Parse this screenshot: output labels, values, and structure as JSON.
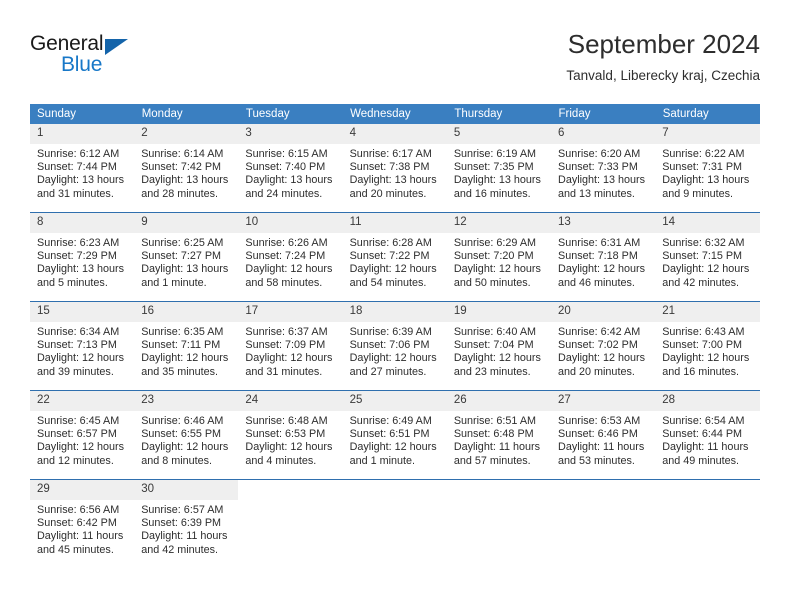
{
  "brand": {
    "word1": "General",
    "word2": "Blue",
    "triangle_color": "#1464aa",
    "blue_color": "#1878c8"
  },
  "header": {
    "title": "September 2024",
    "subtitle": "Tanvald, Liberecky kraj, Czechia"
  },
  "theme": {
    "header_band": "#3a7fc1",
    "row_divider": "#2f6fae",
    "daynum_band": "#efefef",
    "text": "#2d2d2d"
  },
  "weekdays": [
    "Sunday",
    "Monday",
    "Tuesday",
    "Wednesday",
    "Thursday",
    "Friday",
    "Saturday"
  ],
  "labels": {
    "sunrise": "Sunrise:",
    "sunset": "Sunset:",
    "daylight": "Daylight:"
  },
  "weeks": [
    [
      {
        "day": "1",
        "sunrise": "Sunrise: 6:12 AM",
        "sunset": "Sunset: 7:44 PM",
        "daylight_l1": "Daylight: 13 hours",
        "daylight_l2": "and 31 minutes."
      },
      {
        "day": "2",
        "sunrise": "Sunrise: 6:14 AM",
        "sunset": "Sunset: 7:42 PM",
        "daylight_l1": "Daylight: 13 hours",
        "daylight_l2": "and 28 minutes."
      },
      {
        "day": "3",
        "sunrise": "Sunrise: 6:15 AM",
        "sunset": "Sunset: 7:40 PM",
        "daylight_l1": "Daylight: 13 hours",
        "daylight_l2": "and 24 minutes."
      },
      {
        "day": "4",
        "sunrise": "Sunrise: 6:17 AM",
        "sunset": "Sunset: 7:38 PM",
        "daylight_l1": "Daylight: 13 hours",
        "daylight_l2": "and 20 minutes."
      },
      {
        "day": "5",
        "sunrise": "Sunrise: 6:19 AM",
        "sunset": "Sunset: 7:35 PM",
        "daylight_l1": "Daylight: 13 hours",
        "daylight_l2": "and 16 minutes."
      },
      {
        "day": "6",
        "sunrise": "Sunrise: 6:20 AM",
        "sunset": "Sunset: 7:33 PM",
        "daylight_l1": "Daylight: 13 hours",
        "daylight_l2": "and 13 minutes."
      },
      {
        "day": "7",
        "sunrise": "Sunrise: 6:22 AM",
        "sunset": "Sunset: 7:31 PM",
        "daylight_l1": "Daylight: 13 hours",
        "daylight_l2": "and 9 minutes."
      }
    ],
    [
      {
        "day": "8",
        "sunrise": "Sunrise: 6:23 AM",
        "sunset": "Sunset: 7:29 PM",
        "daylight_l1": "Daylight: 13 hours",
        "daylight_l2": "and 5 minutes."
      },
      {
        "day": "9",
        "sunrise": "Sunrise: 6:25 AM",
        "sunset": "Sunset: 7:27 PM",
        "daylight_l1": "Daylight: 13 hours",
        "daylight_l2": "and 1 minute."
      },
      {
        "day": "10",
        "sunrise": "Sunrise: 6:26 AM",
        "sunset": "Sunset: 7:24 PM",
        "daylight_l1": "Daylight: 12 hours",
        "daylight_l2": "and 58 minutes."
      },
      {
        "day": "11",
        "sunrise": "Sunrise: 6:28 AM",
        "sunset": "Sunset: 7:22 PM",
        "daylight_l1": "Daylight: 12 hours",
        "daylight_l2": "and 54 minutes."
      },
      {
        "day": "12",
        "sunrise": "Sunrise: 6:29 AM",
        "sunset": "Sunset: 7:20 PM",
        "daylight_l1": "Daylight: 12 hours",
        "daylight_l2": "and 50 minutes."
      },
      {
        "day": "13",
        "sunrise": "Sunrise: 6:31 AM",
        "sunset": "Sunset: 7:18 PM",
        "daylight_l1": "Daylight: 12 hours",
        "daylight_l2": "and 46 minutes."
      },
      {
        "day": "14",
        "sunrise": "Sunrise: 6:32 AM",
        "sunset": "Sunset: 7:15 PM",
        "daylight_l1": "Daylight: 12 hours",
        "daylight_l2": "and 42 minutes."
      }
    ],
    [
      {
        "day": "15",
        "sunrise": "Sunrise: 6:34 AM",
        "sunset": "Sunset: 7:13 PM",
        "daylight_l1": "Daylight: 12 hours",
        "daylight_l2": "and 39 minutes."
      },
      {
        "day": "16",
        "sunrise": "Sunrise: 6:35 AM",
        "sunset": "Sunset: 7:11 PM",
        "daylight_l1": "Daylight: 12 hours",
        "daylight_l2": "and 35 minutes."
      },
      {
        "day": "17",
        "sunrise": "Sunrise: 6:37 AM",
        "sunset": "Sunset: 7:09 PM",
        "daylight_l1": "Daylight: 12 hours",
        "daylight_l2": "and 31 minutes."
      },
      {
        "day": "18",
        "sunrise": "Sunrise: 6:39 AM",
        "sunset": "Sunset: 7:06 PM",
        "daylight_l1": "Daylight: 12 hours",
        "daylight_l2": "and 27 minutes."
      },
      {
        "day": "19",
        "sunrise": "Sunrise: 6:40 AM",
        "sunset": "Sunset: 7:04 PM",
        "daylight_l1": "Daylight: 12 hours",
        "daylight_l2": "and 23 minutes."
      },
      {
        "day": "20",
        "sunrise": "Sunrise: 6:42 AM",
        "sunset": "Sunset: 7:02 PM",
        "daylight_l1": "Daylight: 12 hours",
        "daylight_l2": "and 20 minutes."
      },
      {
        "day": "21",
        "sunrise": "Sunrise: 6:43 AM",
        "sunset": "Sunset: 7:00 PM",
        "daylight_l1": "Daylight: 12 hours",
        "daylight_l2": "and 16 minutes."
      }
    ],
    [
      {
        "day": "22",
        "sunrise": "Sunrise: 6:45 AM",
        "sunset": "Sunset: 6:57 PM",
        "daylight_l1": "Daylight: 12 hours",
        "daylight_l2": "and 12 minutes."
      },
      {
        "day": "23",
        "sunrise": "Sunrise: 6:46 AM",
        "sunset": "Sunset: 6:55 PM",
        "daylight_l1": "Daylight: 12 hours",
        "daylight_l2": "and 8 minutes."
      },
      {
        "day": "24",
        "sunrise": "Sunrise: 6:48 AM",
        "sunset": "Sunset: 6:53 PM",
        "daylight_l1": "Daylight: 12 hours",
        "daylight_l2": "and 4 minutes."
      },
      {
        "day": "25",
        "sunrise": "Sunrise: 6:49 AM",
        "sunset": "Sunset: 6:51 PM",
        "daylight_l1": "Daylight: 12 hours",
        "daylight_l2": "and 1 minute."
      },
      {
        "day": "26",
        "sunrise": "Sunrise: 6:51 AM",
        "sunset": "Sunset: 6:48 PM",
        "daylight_l1": "Daylight: 11 hours",
        "daylight_l2": "and 57 minutes."
      },
      {
        "day": "27",
        "sunrise": "Sunrise: 6:53 AM",
        "sunset": "Sunset: 6:46 PM",
        "daylight_l1": "Daylight: 11 hours",
        "daylight_l2": "and 53 minutes."
      },
      {
        "day": "28",
        "sunrise": "Sunrise: 6:54 AM",
        "sunset": "Sunset: 6:44 PM",
        "daylight_l1": "Daylight: 11 hours",
        "daylight_l2": "and 49 minutes."
      }
    ],
    [
      {
        "day": "29",
        "sunrise": "Sunrise: 6:56 AM",
        "sunset": "Sunset: 6:42 PM",
        "daylight_l1": "Daylight: 11 hours",
        "daylight_l2": "and 45 minutes."
      },
      {
        "day": "30",
        "sunrise": "Sunrise: 6:57 AM",
        "sunset": "Sunset: 6:39 PM",
        "daylight_l1": "Daylight: 11 hours",
        "daylight_l2": "and 42 minutes."
      },
      {
        "day": "",
        "sunrise": "",
        "sunset": "",
        "daylight_l1": "",
        "daylight_l2": "",
        "empty": true
      },
      {
        "day": "",
        "sunrise": "",
        "sunset": "",
        "daylight_l1": "",
        "daylight_l2": "",
        "empty": true
      },
      {
        "day": "",
        "sunrise": "",
        "sunset": "",
        "daylight_l1": "",
        "daylight_l2": "",
        "empty": true
      },
      {
        "day": "",
        "sunrise": "",
        "sunset": "",
        "daylight_l1": "",
        "daylight_l2": "",
        "empty": true
      },
      {
        "day": "",
        "sunrise": "",
        "sunset": "",
        "daylight_l1": "",
        "daylight_l2": "",
        "empty": true
      }
    ]
  ]
}
